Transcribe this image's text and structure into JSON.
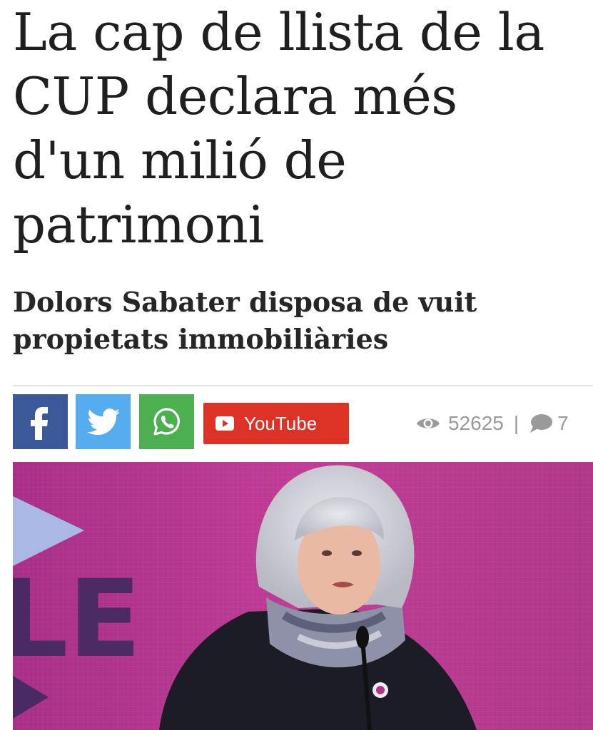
{
  "article": {
    "headline_lines": [
      "La cap de llista de la",
      "CUP declara més",
      "d'un milió de",
      "patrimoni"
    ],
    "subtitle_lines": [
      "Dolors Sabater disposa de vuit",
      "propietats immobiliàries"
    ]
  },
  "share_bar": {
    "facebook_icon": "facebook-icon",
    "twitter_icon": "twitter-icon",
    "whatsapp_icon": "whatsapp-icon",
    "youtube_label": "YouTube"
  },
  "stats": {
    "views": "52625",
    "separator": "|",
    "comments": "7"
  },
  "photo": {
    "backdrop_text": "LE"
  },
  "colors": {
    "facebook": "#3b5998",
    "twitter": "#55acee",
    "whatsapp": "#4caf50",
    "youtube": "#dd3327",
    "backdrop": "#b2348a"
  }
}
